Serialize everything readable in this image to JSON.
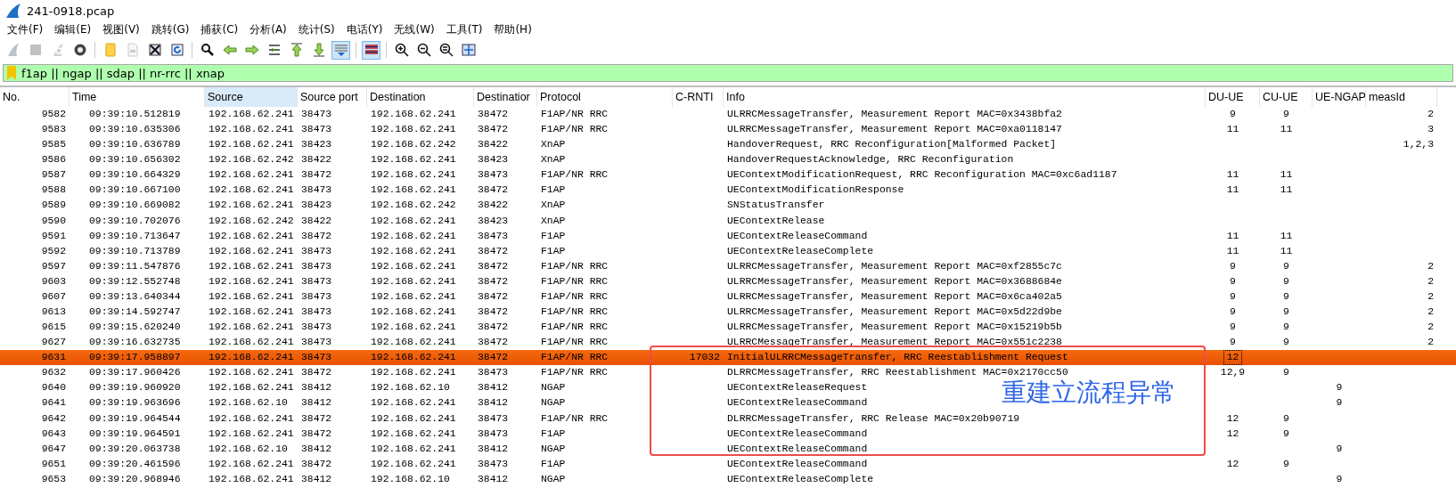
{
  "window": {
    "title": "241-0918.pcap"
  },
  "menu": [
    {
      "label": "文件(F)"
    },
    {
      "label": "编辑(E)"
    },
    {
      "label": "视图(V)"
    },
    {
      "label": "跳转(G)"
    },
    {
      "label": "捕获(C)"
    },
    {
      "label": "分析(A)"
    },
    {
      "label": "统计(S)"
    },
    {
      "label": "电话(Y)"
    },
    {
      "label": "无线(W)"
    },
    {
      "label": "工具(T)"
    },
    {
      "label": "帮助(H)"
    }
  ],
  "toolbar": [
    {
      "kind": "fin",
      "on": false,
      "disabled": true
    },
    {
      "kind": "stop",
      "on": false,
      "disabled": true
    },
    {
      "kind": "restart",
      "on": false,
      "disabled": true
    },
    {
      "kind": "options",
      "on": false,
      "disabled": false
    },
    {
      "kind": "sep"
    },
    {
      "kind": "folder",
      "on": false,
      "disabled": false
    },
    {
      "kind": "binary",
      "on": false,
      "disabled": true
    },
    {
      "kind": "close",
      "on": false,
      "disabled": false
    },
    {
      "kind": "reload",
      "on": false,
      "disabled": false
    },
    {
      "kind": "sep"
    },
    {
      "kind": "find",
      "on": false,
      "disabled": false
    },
    {
      "kind": "back",
      "on": false,
      "disabled": false
    },
    {
      "kind": "forward",
      "on": false,
      "disabled": false
    },
    {
      "kind": "goto",
      "on": false,
      "disabled": false
    },
    {
      "kind": "first",
      "on": false,
      "disabled": false
    },
    {
      "kind": "last",
      "on": false,
      "disabled": false
    },
    {
      "kind": "autoscroll",
      "on": true,
      "disabled": false
    },
    {
      "kind": "sep"
    },
    {
      "kind": "colorize",
      "on": true,
      "disabled": false
    },
    {
      "kind": "sep"
    },
    {
      "kind": "zoom-in",
      "on": false,
      "disabled": false
    },
    {
      "kind": "zoom-out",
      "on": false,
      "disabled": false
    },
    {
      "kind": "zoom-reset",
      "on": false,
      "disabled": false
    },
    {
      "kind": "resize",
      "on": false,
      "disabled": false
    }
  ],
  "filter": {
    "value": "f1ap || ngap || sdap || nr-rrc || xnap"
  },
  "table": {
    "columns": [
      {
        "label": "No.",
        "sorted": false
      },
      {
        "label": "Time",
        "sorted": false
      },
      {
        "label": "Source",
        "sorted": true
      },
      {
        "label": "Source port",
        "sorted": false
      },
      {
        "label": "Destination",
        "sorted": false
      },
      {
        "label": "Destinatior",
        "sorted": false
      },
      {
        "label": "Protocol",
        "sorted": false
      },
      {
        "label": "C-RNTI",
        "sorted": false
      },
      {
        "label": "Info",
        "sorted": false
      },
      {
        "label": "DU-UE",
        "sorted": false
      },
      {
        "label": "CU-UE",
        "sorted": false
      },
      {
        "label": "UE-NGAP",
        "sorted": false
      },
      {
        "label": "measId",
        "sorted": false
      }
    ],
    "rows": [
      {
        "selected": false,
        "cells": [
          "9582",
          "09:39:10.512819",
          "192.168.62.241",
          "38473",
          "192.168.62.241",
          "38472",
          "F1AP/NR RRC",
          "",
          "ULRRCMessageTransfer, Measurement Report MAC=0x3438bfa2",
          "9",
          "9",
          "",
          "2"
        ]
      },
      {
        "selected": false,
        "cells": [
          "9583",
          "09:39:10.635306",
          "192.168.62.241",
          "38473",
          "192.168.62.241",
          "38472",
          "F1AP/NR RRC",
          "",
          "ULRRCMessageTransfer, Measurement Report MAC=0xa0118147",
          "11",
          "11",
          "",
          "3"
        ]
      },
      {
        "selected": false,
        "cells": [
          "9585",
          "09:39:10.636789",
          "192.168.62.241",
          "38423",
          "192.168.62.242",
          "38422",
          "XnAP",
          "",
          "HandoverRequest, RRC Reconfiguration[Malformed Packet]",
          "",
          "",
          "",
          "1,2,3"
        ]
      },
      {
        "selected": false,
        "cells": [
          "9586",
          "09:39:10.656302",
          "192.168.62.242",
          "38422",
          "192.168.62.241",
          "38423",
          "XnAP",
          "",
          "HandoverRequestAcknowledge, RRC Reconfiguration",
          "",
          "",
          "",
          ""
        ]
      },
      {
        "selected": false,
        "cells": [
          "9587",
          "09:39:10.664329",
          "192.168.62.241",
          "38472",
          "192.168.62.241",
          "38473",
          "F1AP/NR RRC",
          "",
          "UEContextModificationRequest, RRC Reconfiguration MAC=0xc6ad1187",
          "11",
          "11",
          "",
          ""
        ]
      },
      {
        "selected": false,
        "cells": [
          "9588",
          "09:39:10.667100",
          "192.168.62.241",
          "38473",
          "192.168.62.241",
          "38472",
          "F1AP",
          "",
          "UEContextModificationResponse",
          "11",
          "11",
          "",
          ""
        ]
      },
      {
        "selected": false,
        "cells": [
          "9589",
          "09:39:10.669082",
          "192.168.62.241",
          "38423",
          "192.168.62.242",
          "38422",
          "XnAP",
          "",
          "SNStatusTransfer",
          "",
          "",
          "",
          ""
        ]
      },
      {
        "selected": false,
        "cells": [
          "9590",
          "09:39:10.702076",
          "192.168.62.242",
          "38422",
          "192.168.62.241",
          "38423",
          "XnAP",
          "",
          "UEContextRelease",
          "",
          "",
          "",
          ""
        ]
      },
      {
        "selected": false,
        "cells": [
          "9591",
          "09:39:10.713647",
          "192.168.62.241",
          "38472",
          "192.168.62.241",
          "38473",
          "F1AP",
          "",
          "UEContextReleaseCommand",
          "11",
          "11",
          "",
          ""
        ]
      },
      {
        "selected": false,
        "cells": [
          "9592",
          "09:39:10.713789",
          "192.168.62.241",
          "38473",
          "192.168.62.241",
          "38472",
          "F1AP",
          "",
          "UEContextReleaseComplete",
          "11",
          "11",
          "",
          ""
        ]
      },
      {
        "selected": false,
        "cells": [
          "9597",
          "09:39:11.547876",
          "192.168.62.241",
          "38473",
          "192.168.62.241",
          "38472",
          "F1AP/NR RRC",
          "",
          "ULRRCMessageTransfer, Measurement Report MAC=0xf2855c7c",
          "9",
          "9",
          "",
          "2"
        ]
      },
      {
        "selected": false,
        "cells": [
          "9603",
          "09:39:12.552748",
          "192.168.62.241",
          "38473",
          "192.168.62.241",
          "38472",
          "F1AP/NR RRC",
          "",
          "ULRRCMessageTransfer, Measurement Report MAC=0x3688684e",
          "9",
          "9",
          "",
          "2"
        ]
      },
      {
        "selected": false,
        "cells": [
          "9607",
          "09:39:13.640344",
          "192.168.62.241",
          "38473",
          "192.168.62.241",
          "38472",
          "F1AP/NR RRC",
          "",
          "ULRRCMessageTransfer, Measurement Report MAC=0x6ca402a5",
          "9",
          "9",
          "",
          "2"
        ]
      },
      {
        "selected": false,
        "cells": [
          "9613",
          "09:39:14.592747",
          "192.168.62.241",
          "38473",
          "192.168.62.241",
          "38472",
          "F1AP/NR RRC",
          "",
          "ULRRCMessageTransfer, Measurement Report MAC=0x5d22d9be",
          "9",
          "9",
          "",
          "2"
        ]
      },
      {
        "selected": false,
        "cells": [
          "9615",
          "09:39:15.620240",
          "192.168.62.241",
          "38473",
          "192.168.62.241",
          "38472",
          "F1AP/NR RRC",
          "",
          "ULRRCMessageTransfer, Measurement Report MAC=0x15219b5b",
          "9",
          "9",
          "",
          "2"
        ]
      },
      {
        "selected": false,
        "cells": [
          "9627",
          "09:39:16.632735",
          "192.168.62.241",
          "38473",
          "192.168.62.241",
          "38472",
          "F1AP/NR RRC",
          "",
          "ULRRCMessageTransfer, Measurement Report MAC=0x551c2238",
          "9",
          "9",
          "",
          "2"
        ]
      },
      {
        "selected": true,
        "cells": [
          "9631",
          "09:39:17.958897",
          "192.168.62.241",
          "38473",
          "192.168.62.241",
          "38472",
          "F1AP/NR RRC",
          "17032",
          "InitialULRRCMessageTransfer, RRC Reestablishment Request",
          "12",
          "",
          "",
          ""
        ]
      },
      {
        "selected": false,
        "cells": [
          "9632",
          "09:39:17.960426",
          "192.168.62.241",
          "38472",
          "192.168.62.241",
          "38473",
          "F1AP/NR RRC",
          "",
          "DLRRCMessageTransfer, RRC Reestablishment MAC=0x2170cc50",
          "12,9",
          "9",
          "",
          ""
        ]
      },
      {
        "selected": false,
        "cells": [
          "9640",
          "09:39:19.960920",
          "192.168.62.241",
          "38412",
          "192.168.62.10",
          "38412",
          "NGAP",
          "",
          "UEContextReleaseRequest",
          "",
          "",
          "9",
          ""
        ]
      },
      {
        "selected": false,
        "cells": [
          "9641",
          "09:39:19.963696",
          "192.168.62.10",
          "38412",
          "192.168.62.241",
          "38412",
          "NGAP",
          "",
          "UEContextReleaseCommand",
          "",
          "",
          "9",
          ""
        ]
      },
      {
        "selected": false,
        "cells": [
          "9642",
          "09:39:19.964544",
          "192.168.62.241",
          "38472",
          "192.168.62.241",
          "38473",
          "F1AP/NR RRC",
          "",
          "DLRRCMessageTransfer, RRC Release MAC=0x20b90719",
          "12",
          "9",
          "",
          ""
        ]
      },
      {
        "selected": false,
        "cells": [
          "9643",
          "09:39:19.964591",
          "192.168.62.241",
          "38472",
          "192.168.62.241",
          "38473",
          "F1AP",
          "",
          "UEContextReleaseCommand",
          "12",
          "9",
          "",
          ""
        ]
      },
      {
        "selected": false,
        "cells": [
          "9647",
          "09:39:20.063738",
          "192.168.62.10",
          "38412",
          "192.168.62.241",
          "38412",
          "NGAP",
          "",
          "UEContextReleaseCommand",
          "",
          "",
          "9",
          ""
        ]
      },
      {
        "selected": false,
        "cells": [
          "9651",
          "09:39:20.461596",
          "192.168.62.241",
          "38472",
          "192.168.62.241",
          "38473",
          "F1AP",
          "",
          "UEContextReleaseCommand",
          "12",
          "9",
          "",
          ""
        ]
      },
      {
        "selected": false,
        "cells": [
          "9653",
          "09:39:20.968946",
          "192.168.62.241",
          "38412",
          "192.168.62.10",
          "38412",
          "NGAP",
          "",
          "UEContextReleaseComplete",
          "",
          "",
          "9",
          ""
        ]
      }
    ]
  },
  "annotation": {
    "text": "重建立流程异常"
  }
}
